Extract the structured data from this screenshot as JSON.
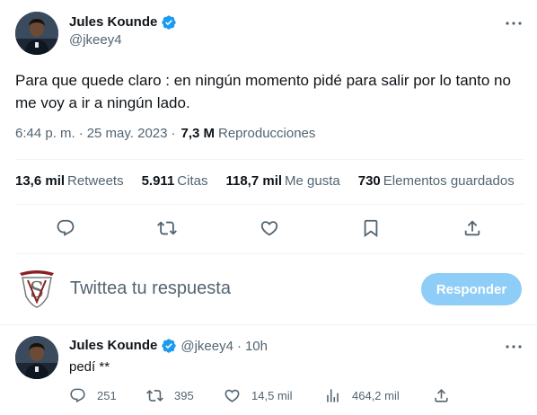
{
  "tweet": {
    "display_name": "Jules Kounde",
    "handle": "@jkeey4",
    "text": "Para que quede claro : en ningún momento pidé para salir por lo tanto no me voy a ir a ningún lado.",
    "time": "6:44 p. m.",
    "separator": "·",
    "date": "25 may. 2023",
    "views_count": "7,3 M",
    "views_label": "Reproducciones",
    "stats": [
      {
        "count": "13,6 mil",
        "label": "Retweets"
      },
      {
        "count": "5.911",
        "label": "Citas"
      },
      {
        "count": "118,7 mil",
        "label": "Me gusta"
      },
      {
        "count": "730",
        "label": "Elementos guardados"
      }
    ],
    "actions": [
      "reply-icon",
      "retweet-icon",
      "like-icon",
      "bookmark-icon",
      "share-icon"
    ]
  },
  "compose": {
    "placeholder": "Twittea tu respuesta",
    "button_label": "Responder"
  },
  "reply": {
    "display_name": "Jules Kounde",
    "handle": "@jkeey4",
    "dot": "·",
    "time": "10h",
    "text": "pedí **",
    "actions": [
      {
        "icon": "reply-icon",
        "count": "251"
      },
      {
        "icon": "retweet-icon",
        "count": "395"
      },
      {
        "icon": "like-icon",
        "count": "14,5 mil"
      },
      {
        "icon": "views-icon",
        "count": "464,2 mil"
      },
      {
        "icon": "share-icon",
        "count": ""
      }
    ]
  },
  "colors": {
    "text_primary": "#0f1419",
    "text_secondary": "#536471",
    "verified_blue": "#1d9bf0",
    "button_disabled": "#8ecdf7",
    "divider": "#eff3f4"
  }
}
